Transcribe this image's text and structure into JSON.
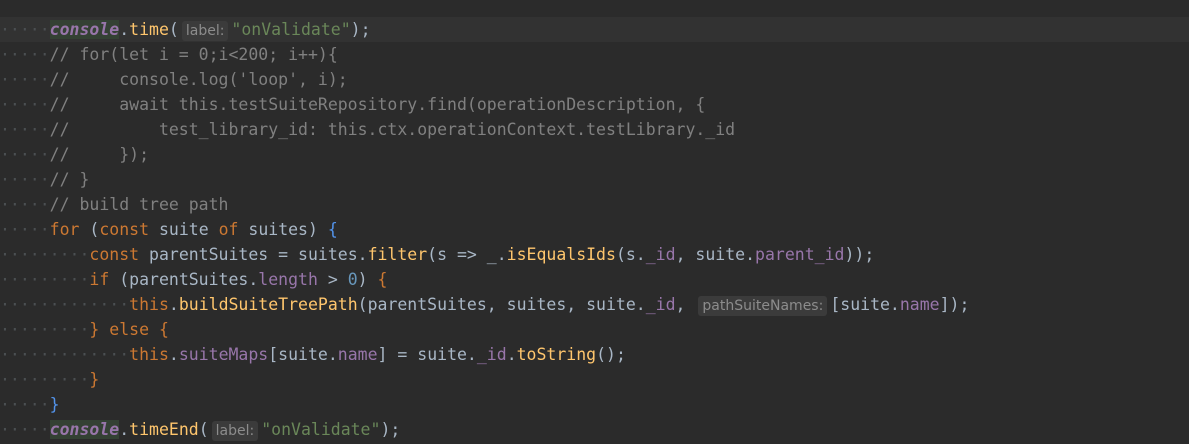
{
  "lines": [
    {
      "dots": "",
      "tokens": []
    },
    {
      "dots": "·····",
      "tokens": [
        {
          "t": "console",
          "c": "t-console"
        },
        {
          "t": ".",
          "c": "t-default"
        },
        {
          "t": "time",
          "c": "t-func"
        },
        {
          "t": "(",
          "c": "t-default"
        },
        {
          "hint": "label:"
        },
        {
          "t": "\"onValidate\"",
          "c": "t-str"
        },
        {
          "t": ");",
          "c": "t-default"
        }
      ]
    },
    {
      "dots": "·····",
      "tokens": [
        {
          "t": "// for(let i = 0;i<200; i++){",
          "c": "t-cmt"
        }
      ]
    },
    {
      "dots": "·····",
      "tokens": [
        {
          "t": "//     console.log('loop', i);",
          "c": "t-cmt"
        }
      ]
    },
    {
      "dots": "·····",
      "tokens": [
        {
          "t": "//     await this.testSuiteRepository.find(operationDescription, {",
          "c": "t-cmt"
        }
      ]
    },
    {
      "dots": "·····",
      "tokens": [
        {
          "t": "//         test_library_id: this.ctx.operationContext.testLibrary._id",
          "c": "t-cmt"
        }
      ]
    },
    {
      "dots": "·····",
      "tokens": [
        {
          "t": "//     });",
          "c": "t-cmt"
        }
      ]
    },
    {
      "dots": "·····",
      "tokens": [
        {
          "t": "// }",
          "c": "t-cmt"
        }
      ]
    },
    {
      "dots": "·····",
      "tokens": [
        {
          "t": "// build tree path",
          "c": "t-cmt"
        }
      ]
    },
    {
      "dots": "·····",
      "tokens": [
        {
          "t": "for",
          "c": "t-kw"
        },
        {
          "t": " (",
          "c": "t-default"
        },
        {
          "t": "const",
          "c": "t-kw"
        },
        {
          "t": " suite ",
          "c": "t-default"
        },
        {
          "t": "of",
          "c": "t-kw"
        },
        {
          "t": " suites) ",
          "c": "t-default"
        },
        {
          "t": "{",
          "c": "t-brace1"
        }
      ]
    },
    {
      "dots": "·········",
      "tokens": [
        {
          "t": "const",
          "c": "t-kw"
        },
        {
          "t": " parentSuites = suites.",
          "c": "t-default"
        },
        {
          "t": "filter",
          "c": "t-func"
        },
        {
          "t": "(s => _.",
          "c": "t-default"
        },
        {
          "t": "isEqualsIds",
          "c": "t-func"
        },
        {
          "t": "(s.",
          "c": "t-default"
        },
        {
          "t": "_id",
          "c": "t-field"
        },
        {
          "t": ", suite.",
          "c": "t-default"
        },
        {
          "t": "parent_id",
          "c": "t-field"
        },
        {
          "t": "));",
          "c": "t-default"
        }
      ]
    },
    {
      "dots": "·········",
      "tokens": [
        {
          "t": "if",
          "c": "t-kw"
        },
        {
          "t": " (parentSuites.",
          "c": "t-default"
        },
        {
          "t": "length",
          "c": "t-field"
        },
        {
          "t": " > ",
          "c": "t-default"
        },
        {
          "t": "0",
          "c": "t-num"
        },
        {
          "t": ") ",
          "c": "t-default"
        },
        {
          "t": "{",
          "c": "t-brace2"
        }
      ]
    },
    {
      "dots": "·············",
      "tokens": [
        {
          "t": "this",
          "c": "t-kw"
        },
        {
          "t": ".",
          "c": "t-default"
        },
        {
          "t": "buildSuiteTreePath",
          "c": "t-func"
        },
        {
          "t": "(parentSuites, suites, suite.",
          "c": "t-default"
        },
        {
          "t": "_id",
          "c": "t-field"
        },
        {
          "t": ", ",
          "c": "t-default"
        },
        {
          "hint": "pathSuiteNames:"
        },
        {
          "t": "[suite.",
          "c": "t-default"
        },
        {
          "t": "name",
          "c": "t-field"
        },
        {
          "t": "]);",
          "c": "t-default"
        }
      ]
    },
    {
      "dots": "·········",
      "tokens": [
        {
          "t": "}",
          "c": "t-brace2"
        },
        {
          "t": " ",
          "c": "t-default"
        },
        {
          "t": "else",
          "c": "t-kw"
        },
        {
          "t": " ",
          "c": "t-default"
        },
        {
          "t": "{",
          "c": "t-brace2"
        }
      ]
    },
    {
      "dots": "·············",
      "tokens": [
        {
          "t": "this",
          "c": "t-kw"
        },
        {
          "t": ".",
          "c": "t-default"
        },
        {
          "t": "suiteMaps",
          "c": "t-field"
        },
        {
          "t": "[suite.",
          "c": "t-default"
        },
        {
          "t": "name",
          "c": "t-field"
        },
        {
          "t": "] = suite.",
          "c": "t-default"
        },
        {
          "t": "_id",
          "c": "t-field"
        },
        {
          "t": ".",
          "c": "t-default"
        },
        {
          "t": "toString",
          "c": "t-func"
        },
        {
          "t": "();",
          "c": "t-default"
        }
      ]
    },
    {
      "dots": "·········",
      "tokens": [
        {
          "t": "}",
          "c": "t-brace2"
        }
      ]
    },
    {
      "dots": "·····",
      "tokens": [
        {
          "t": "}",
          "c": "t-brace1"
        }
      ]
    },
    {
      "dots": "·····",
      "tokens": [
        {
          "t": "console",
          "c": "t-console"
        },
        {
          "t": ".",
          "c": "t-default"
        },
        {
          "t": "timeEnd",
          "c": "t-func"
        },
        {
          "t": "(",
          "c": "t-default"
        },
        {
          "hint": "label:"
        },
        {
          "t": "\"onValidate\"",
          "c": "t-str"
        },
        {
          "t": ");",
          "c": "t-default"
        }
      ]
    }
  ]
}
